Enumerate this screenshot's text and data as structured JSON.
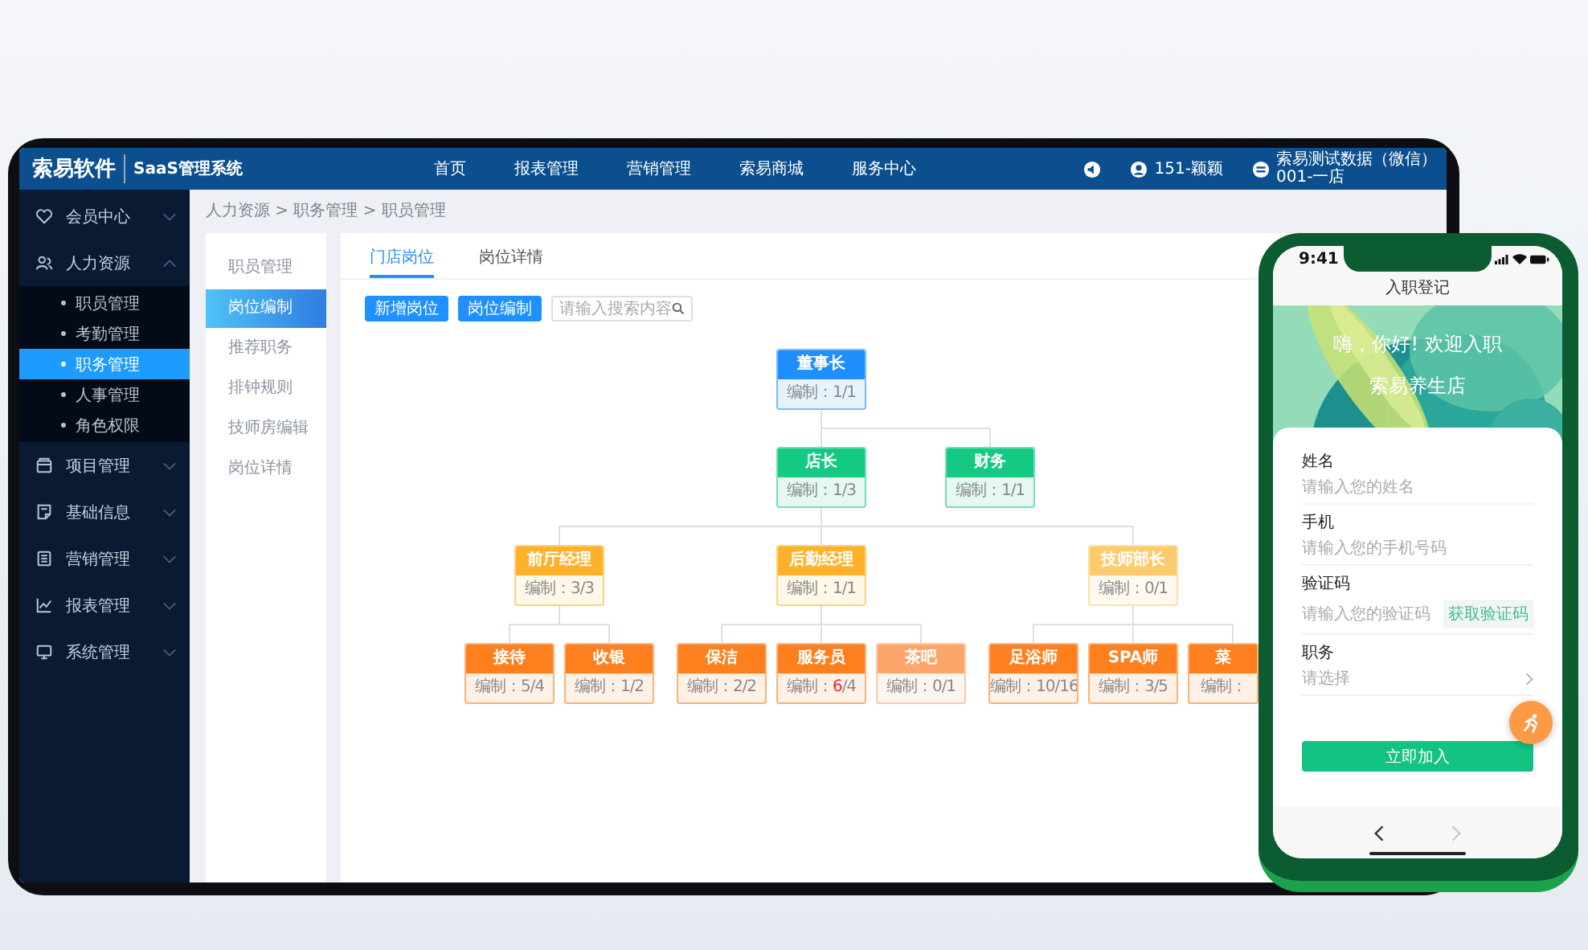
{
  "header": {
    "logo": "索易软件",
    "system": "SaaS管理系统",
    "nav": [
      "首页",
      "报表管理",
      "营销管理",
      "索易商城",
      "服务中心"
    ],
    "user": "151-颖颖",
    "store": "索易测试数据（微信）",
    "store_code": "001-一店"
  },
  "sidebar": {
    "items": [
      {
        "label": "会员中心",
        "expanded": false
      },
      {
        "label": "人力资源",
        "expanded": true,
        "children": [
          {
            "label": "职员管理",
            "selected": false
          },
          {
            "label": "考勤管理",
            "selected": false
          },
          {
            "label": "职务管理",
            "selected": true
          },
          {
            "label": "人事管理",
            "selected": false
          },
          {
            "label": "角色权限",
            "selected": false
          }
        ]
      },
      {
        "label": "项目管理",
        "expanded": false
      },
      {
        "label": "基础信息",
        "expanded": false
      },
      {
        "label": "营销管理",
        "expanded": false
      },
      {
        "label": "报表管理",
        "expanded": false
      },
      {
        "label": "系统管理",
        "expanded": false
      }
    ]
  },
  "breadcrumb": "人力资源 > 职务管理 > 职员管理",
  "subnav": {
    "items": [
      {
        "label": "职员管理",
        "selected": false
      },
      {
        "label": "岗位编制",
        "selected": true
      },
      {
        "label": "推荐职务",
        "selected": false
      },
      {
        "label": "排钟规则",
        "selected": false
      },
      {
        "label": "技师房编辑",
        "selected": false
      },
      {
        "label": "岗位详情",
        "selected": false
      }
    ]
  },
  "tabs": [
    {
      "label": "门店岗位",
      "selected": true
    },
    {
      "label": "岗位详情",
      "selected": false
    }
  ],
  "buttons": [
    "新增岗位",
    "岗位编制"
  ],
  "search": {
    "placeholder": "请输入搜索内容"
  },
  "org_chart": {
    "title": "董事长",
    "quota_label": "编制：",
    "filled": "1",
    "rest": "/1",
    "over": false,
    "color": "#1f8ffd",
    "children": [
      {
        "title": "店长",
        "quota_label": "编制：",
        "filled": "1",
        "rest": "/3",
        "over": false,
        "color": "#14c984",
        "children": [
          {
            "title": "前厅经理",
            "quota_label": "编制：",
            "filled": "3",
            "rest": "/3",
            "over": false,
            "color": "#fdb22a",
            "children": [
              {
                "title": "接待",
                "quota_label": "编制：",
                "filled": "5",
                "rest": "/4",
                "over": false,
                "color": "#fd7f1e"
              },
              {
                "title": "收银",
                "quota_label": "编制：",
                "filled": "1",
                "rest": "/2",
                "over": false,
                "color": "#fd7f1e"
              }
            ]
          },
          {
            "title": "后勤经理",
            "quota_label": "编制：",
            "filled": "1",
            "rest": "/1",
            "over": false,
            "color": "#fdb22a",
            "children": [
              {
                "title": "保洁",
                "quota_label": "编制：",
                "filled": "2",
                "rest": "/2",
                "over": false,
                "color": "#fd7f1e"
              },
              {
                "title": "服务员",
                "quota_label": "编制：",
                "filled": "6",
                "rest": "/4",
                "over": true,
                "color": "#fd7f1e"
              },
              {
                "title": "茶吧",
                "quota_label": "编制：",
                "filled": "0",
                "rest": "/1",
                "over": false,
                "color": "#fca66b"
              }
            ]
          },
          {
            "title": "技师部长",
            "quota_label": "编制：",
            "filled": "0",
            "rest": "/1",
            "over": false,
            "color": "#fdcb6e",
            "children": [
              {
                "title": "足浴师",
                "quota_label": "编制：",
                "filled": "10",
                "rest": "/16",
                "over": false,
                "color": "#fd7f1e"
              },
              {
                "title": "SPA师",
                "quota_label": "编制：",
                "filled": "3",
                "rest": "/5",
                "over": false,
                "color": "#fd7f1e"
              },
              {
                "title": "菜",
                "quota_label": "编制：",
                "color": "#fd7f1e"
              }
            ]
          }
        ]
      },
      {
        "title": "财务",
        "quota_label": "编制：",
        "filled": "1",
        "rest": "/1",
        "over": false,
        "color": "#14c984"
      }
    ]
  },
  "phone": {
    "time": "9:41",
    "title": "入职登记",
    "greeting": "嗨，你好! 欢迎入职",
    "shop": "索易养生店",
    "fields": [
      {
        "label": "姓名",
        "placeholder": "请输入您的姓名",
        "kind": "text"
      },
      {
        "label": "手机",
        "placeholder": "请输入您的手机号码",
        "kind": "text"
      },
      {
        "label": "验证码",
        "placeholder": "请输入您的验证码",
        "kind": "code",
        "action": "获取验证码"
      },
      {
        "label": "职务",
        "placeholder": "请选择",
        "kind": "select"
      }
    ],
    "submit": "立即加入",
    "history_buttons": [
      {
        "kind": "back",
        "disabled": false
      },
      {
        "kind": "forward",
        "disabled": true
      }
    ]
  }
}
